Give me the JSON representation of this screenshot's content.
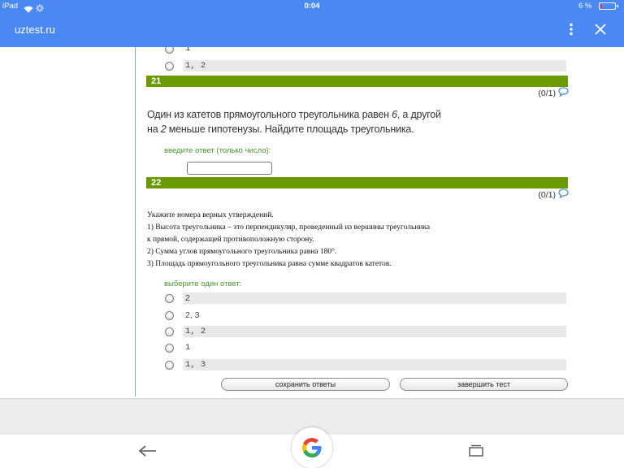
{
  "status_bar": {
    "device_label": "iPad",
    "time": "0:04",
    "battery_text": "6 %",
    "battery_level": 0.06,
    "icons": [
      "wifi-icon",
      "activity-spinner-icon",
      "battery-icon"
    ]
  },
  "app_bar": {
    "title": "uztest.ru",
    "icons": [
      "more-vert-icon",
      "close-icon"
    ]
  },
  "previous_question": {
    "options": [
      "1",
      "1, 2"
    ]
  },
  "question_21": {
    "number": "21",
    "score": "(0/1)",
    "text_line1": {
      "before": "Один из катетов прямоугольного треугольника равен ",
      "value": "6",
      "after": ", а другой"
    },
    "text_line2": {
      "before": "на ",
      "value": "2",
      "after": " меньше гипотенузы. Найдите площадь треугольника."
    },
    "prompt": "введите ответ (только число):",
    "answer_value": ""
  },
  "question_22": {
    "number": "22",
    "score": "(0/1)",
    "text_lines": [
      "Укажите номера верных утверждений.",
      "1) Высота треугольника – это перпендикуляр, проведенный из вершины треугольника",
      "к прямой, содержащей противоположную сторону.",
      "2) Сумма углов прямоугольного треугольника равна 180°.",
      "3) Площадь прямоугольного треугольника равна сумме квадратов катетов."
    ],
    "prompt": "выберите один ответ:",
    "options": [
      "2",
      "2, 3",
      "1, 2",
      "1",
      "1, 3"
    ]
  },
  "actions": {
    "save_label": "сохранить ответы",
    "finish_label": "завершить тест"
  },
  "bottom_nav": {
    "icons": [
      "back-arrow-icon",
      "google-g-icon",
      "tabs-icon"
    ]
  },
  "colors": {
    "app_bar": "#4a89f3",
    "question_bar": "#6a9a00",
    "prompt_text": "#47962a",
    "comment_icon": "#4a90d9"
  }
}
